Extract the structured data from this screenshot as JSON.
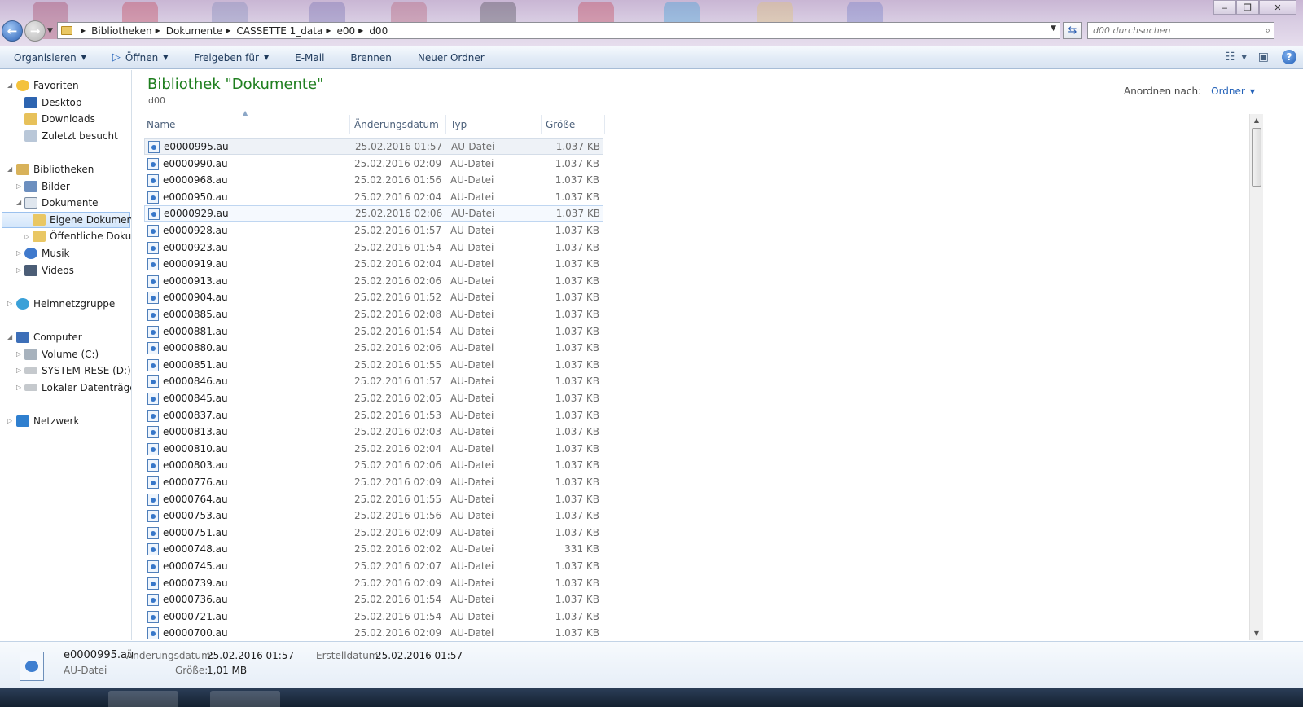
{
  "window": {
    "title_controls": {
      "minimize": "‒",
      "maximize": "❐",
      "close": "✕"
    }
  },
  "address": {
    "crumbs": [
      "Bibliotheken",
      "Dokumente",
      "CASSETTE 1_data",
      "e00",
      "d00"
    ]
  },
  "search": {
    "placeholder": "d00 durchsuchen"
  },
  "toolbar": {
    "organize": "Organisieren",
    "open": "Öffnen",
    "share": "Freigeben für",
    "email": "E-Mail",
    "burn": "Brennen",
    "new_folder": "Neuer Ordner"
  },
  "nav": {
    "favorites": "Favoriten",
    "desktop": "Desktop",
    "downloads": "Downloads",
    "recent": "Zuletzt besucht",
    "libraries": "Bibliotheken",
    "pictures": "Bilder",
    "documents": "Dokumente",
    "my_documents": "Eigene Dokumente",
    "public_documents": "Öffentliche Dokume",
    "music": "Musik",
    "videos": "Videos",
    "homegroup": "Heimnetzgruppe",
    "computer": "Computer",
    "volume_c": "Volume (C:)",
    "system_d": "SYSTEM-RESE (D:)",
    "local_disk": "Lokaler Datenträger (E",
    "network": "Netzwerk"
  },
  "library": {
    "title": "Bibliothek \"Dokumente\"",
    "subtitle": "d00",
    "arrange_label": "Anordnen nach:",
    "arrange_value": "Ordner"
  },
  "columns": {
    "name": "Name",
    "date": "Änderungsdatum",
    "type": "Typ",
    "size": "Größe"
  },
  "files": [
    {
      "name": "e0000995.au",
      "date": "25.02.2016 01:57",
      "type": "AU-Datei",
      "size": "1.037 KB"
    },
    {
      "name": "e0000990.au",
      "date": "25.02.2016 02:09",
      "type": "AU-Datei",
      "size": "1.037 KB"
    },
    {
      "name": "e0000968.au",
      "date": "25.02.2016 01:56",
      "type": "AU-Datei",
      "size": "1.037 KB"
    },
    {
      "name": "e0000950.au",
      "date": "25.02.2016 02:04",
      "type": "AU-Datei",
      "size": "1.037 KB"
    },
    {
      "name": "e0000929.au",
      "date": "25.02.2016 02:06",
      "type": "AU-Datei",
      "size": "1.037 KB"
    },
    {
      "name": "e0000928.au",
      "date": "25.02.2016 01:57",
      "type": "AU-Datei",
      "size": "1.037 KB"
    },
    {
      "name": "e0000923.au",
      "date": "25.02.2016 01:54",
      "type": "AU-Datei",
      "size": "1.037 KB"
    },
    {
      "name": "e0000919.au",
      "date": "25.02.2016 02:04",
      "type": "AU-Datei",
      "size": "1.037 KB"
    },
    {
      "name": "e0000913.au",
      "date": "25.02.2016 02:06",
      "type": "AU-Datei",
      "size": "1.037 KB"
    },
    {
      "name": "e0000904.au",
      "date": "25.02.2016 01:52",
      "type": "AU-Datei",
      "size": "1.037 KB"
    },
    {
      "name": "e0000885.au",
      "date": "25.02.2016 02:08",
      "type": "AU-Datei",
      "size": "1.037 KB"
    },
    {
      "name": "e0000881.au",
      "date": "25.02.2016 01:54",
      "type": "AU-Datei",
      "size": "1.037 KB"
    },
    {
      "name": "e0000880.au",
      "date": "25.02.2016 02:06",
      "type": "AU-Datei",
      "size": "1.037 KB"
    },
    {
      "name": "e0000851.au",
      "date": "25.02.2016 01:55",
      "type": "AU-Datei",
      "size": "1.037 KB"
    },
    {
      "name": "e0000846.au",
      "date": "25.02.2016 01:57",
      "type": "AU-Datei",
      "size": "1.037 KB"
    },
    {
      "name": "e0000845.au",
      "date": "25.02.2016 02:05",
      "type": "AU-Datei",
      "size": "1.037 KB"
    },
    {
      "name": "e0000837.au",
      "date": "25.02.2016 01:53",
      "type": "AU-Datei",
      "size": "1.037 KB"
    },
    {
      "name": "e0000813.au",
      "date": "25.02.2016 02:03",
      "type": "AU-Datei",
      "size": "1.037 KB"
    },
    {
      "name": "e0000810.au",
      "date": "25.02.2016 02:04",
      "type": "AU-Datei",
      "size": "1.037 KB"
    },
    {
      "name": "e0000803.au",
      "date": "25.02.2016 02:06",
      "type": "AU-Datei",
      "size": "1.037 KB"
    },
    {
      "name": "e0000776.au",
      "date": "25.02.2016 02:09",
      "type": "AU-Datei",
      "size": "1.037 KB"
    },
    {
      "name": "e0000764.au",
      "date": "25.02.2016 01:55",
      "type": "AU-Datei",
      "size": "1.037 KB"
    },
    {
      "name": "e0000753.au",
      "date": "25.02.2016 01:56",
      "type": "AU-Datei",
      "size": "1.037 KB"
    },
    {
      "name": "e0000751.au",
      "date": "25.02.2016 02:09",
      "type": "AU-Datei",
      "size": "1.037 KB"
    },
    {
      "name": "e0000748.au",
      "date": "25.02.2016 02:02",
      "type": "AU-Datei",
      "size": "331 KB"
    },
    {
      "name": "e0000745.au",
      "date": "25.02.2016 02:07",
      "type": "AU-Datei",
      "size": "1.037 KB"
    },
    {
      "name": "e0000739.au",
      "date": "25.02.2016 02:09",
      "type": "AU-Datei",
      "size": "1.037 KB"
    },
    {
      "name": "e0000736.au",
      "date": "25.02.2016 01:54",
      "type": "AU-Datei",
      "size": "1.037 KB"
    },
    {
      "name": "e0000721.au",
      "date": "25.02.2016 01:54",
      "type": "AU-Datei",
      "size": "1.037 KB"
    },
    {
      "name": "e0000700.au",
      "date": "25.02.2016 02:09",
      "type": "AU-Datei",
      "size": "1.037 KB"
    }
  ],
  "details": {
    "filename": "e0000995.au",
    "type": "AU-Datei",
    "modified_label": "Änderungsdatum:",
    "modified_value": "25.02.2016 01:57",
    "size_label": "Größe:",
    "size_value": "1,01 MB",
    "created_label": "Erstelldatum:",
    "created_value": "25.02.2016 01:57"
  },
  "colors": {
    "accent_title": "#1e7e1e",
    "link_blue": "#2361b8"
  }
}
